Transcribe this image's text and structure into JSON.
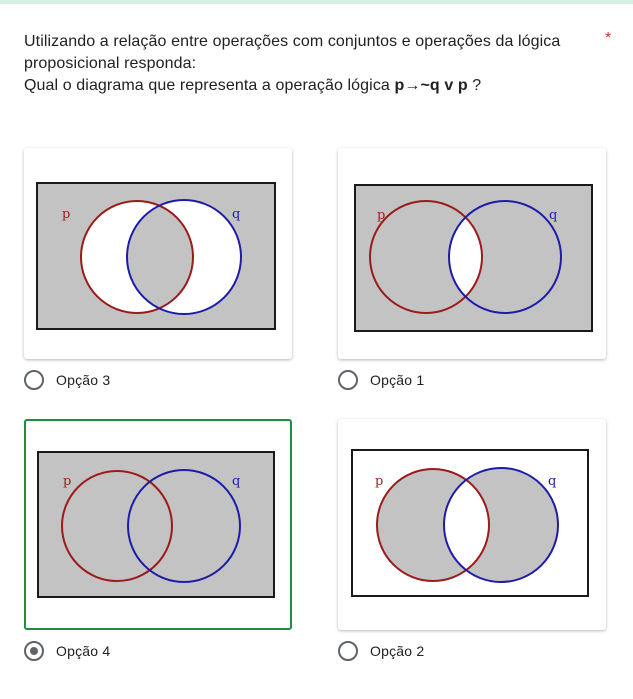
{
  "question": {
    "line1": "Utilizando a relação entre operações com conjuntos e operações da lógica",
    "line2": "proposicional responda:",
    "line3_prefix": "Qual o diagrama que representa a operação lógica ",
    "line3_expr": "p→~q v p",
    "line3_suffix": " ?",
    "required_mark": "*"
  },
  "venn_labels": {
    "p": "p",
    "q": "q"
  },
  "colors": {
    "accent_selected": "#1e8e3e",
    "required": "#d93025",
    "circle_p": "#9b1b1b",
    "circle_q": "#1c1ca8",
    "shade": "#c3c3c3"
  },
  "options": [
    {
      "label": "Opção 3",
      "selected": false
    },
    {
      "label": "Opção 1",
      "selected": false
    },
    {
      "label": "Opção 4",
      "selected": true
    },
    {
      "label": "Opção 2",
      "selected": false
    }
  ]
}
